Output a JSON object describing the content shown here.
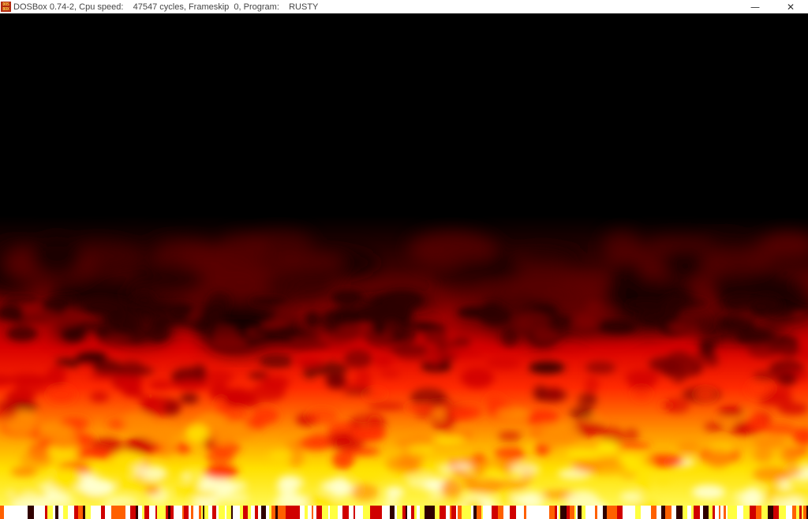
{
  "window": {
    "title": "DOSBox 0.74-2, Cpu speed:    47547 cycles, Frameskip  0, Program:    RUSTY",
    "icon_lines": [
      "DOS",
      "BOX"
    ],
    "minimize_glyph": "—",
    "close_glyph": "✕"
  },
  "screen": {
    "program": "RUSTY",
    "content": "fire-effect",
    "palette": {
      "black": "#000000",
      "dark_red": "#5a0000",
      "red": "#e00000",
      "orange": "#ff6a00",
      "yellow": "#ffff00",
      "white": "#ffffff"
    }
  }
}
